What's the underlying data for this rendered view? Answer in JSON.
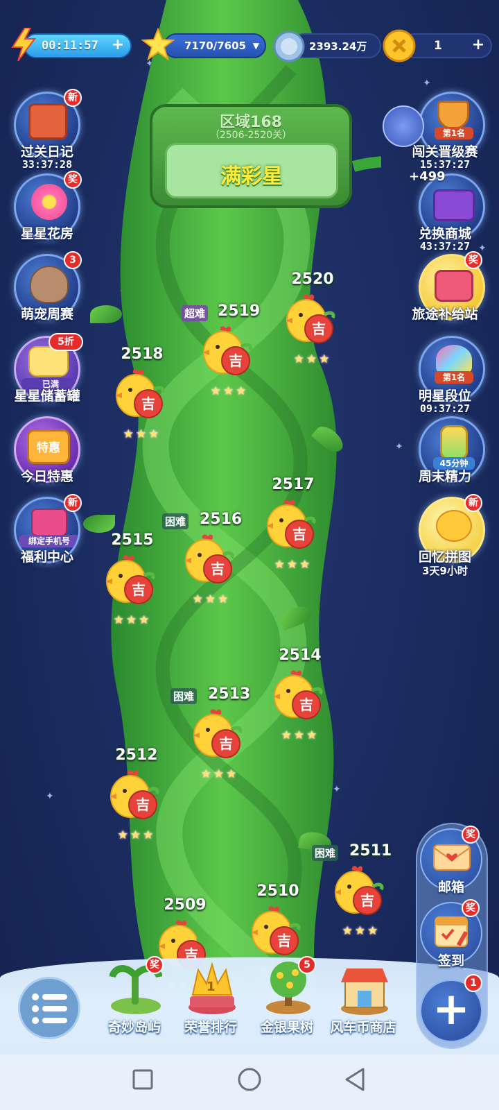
{
  "topbar": {
    "energy_timer": "00:11:57",
    "energy_plus": "+",
    "stars_value": "7170/7605",
    "stars_dropdown": "▼",
    "coin_value": "2393.24万",
    "gold_value": "1",
    "gold_plus": "+"
  },
  "left_buttons": [
    {
      "label": "过关日记",
      "timer": "33:37:28",
      "badge": "新"
    },
    {
      "label": "星星花房",
      "badge": "奖"
    },
    {
      "label": "萌宠周赛",
      "badge": "3"
    },
    {
      "label": "星星储蓄罐",
      "badge": "5折",
      "tag": "已满"
    },
    {
      "label": "今日特惠",
      "tag": "特惠"
    },
    {
      "label": "福利中心",
      "badge": "新",
      "tag": "绑定手机号"
    }
  ],
  "right_buttons": [
    {
      "label": "闯关晋级赛",
      "timer": "15:37:27",
      "tag": "第1名"
    },
    {
      "label": "兑换商城",
      "timer": "43:37:27",
      "plus": "+499"
    },
    {
      "label": "旅途补给站",
      "badge": "奖"
    },
    {
      "label": "明星段位",
      "timer": "09:37:27",
      "tag": "第1名"
    },
    {
      "label": "周末精力",
      "tag": "45分钟"
    },
    {
      "label": "回忆拼图",
      "timer": "3天9小时",
      "badge": "新"
    }
  ],
  "zone": {
    "title": "区域168",
    "range": "（2506-2520关）",
    "name": "满彩星"
  },
  "levels": [
    {
      "num": "2520",
      "tag": ""
    },
    {
      "num": "2519",
      "tag": "超难"
    },
    {
      "num": "2518",
      "tag": ""
    },
    {
      "num": "2517",
      "tag": ""
    },
    {
      "num": "2516",
      "tag": "困难"
    },
    {
      "num": "2515",
      "tag": ""
    },
    {
      "num": "2514",
      "tag": ""
    },
    {
      "num": "2513",
      "tag": "困难"
    },
    {
      "num": "2512",
      "tag": ""
    },
    {
      "num": "2511",
      "tag": "困难"
    },
    {
      "num": "2510",
      "tag": ""
    },
    {
      "num": "2509",
      "tag": ""
    }
  ],
  "stars_glyph": "★★★",
  "chick_char": "吉",
  "bottom_bar": [
    {
      "label": "奇妙岛屿",
      "badge": "奖"
    },
    {
      "label": "荣誉排行",
      "medal": "1"
    },
    {
      "label": "金银果树",
      "badge": "5"
    },
    {
      "label": "风车币商店"
    }
  ],
  "right_panel": {
    "mail_label": "邮箱",
    "mail_badge": "奖",
    "checkin_label": "签到",
    "checkin_badge": "奖",
    "add_badge": "1",
    "add_symbol": "+"
  },
  "colors": {
    "background": "#1a2b5e",
    "stalk": "#3fae3a",
    "badge": "#e62b2b",
    "zone_name": "#ffea3b"
  }
}
